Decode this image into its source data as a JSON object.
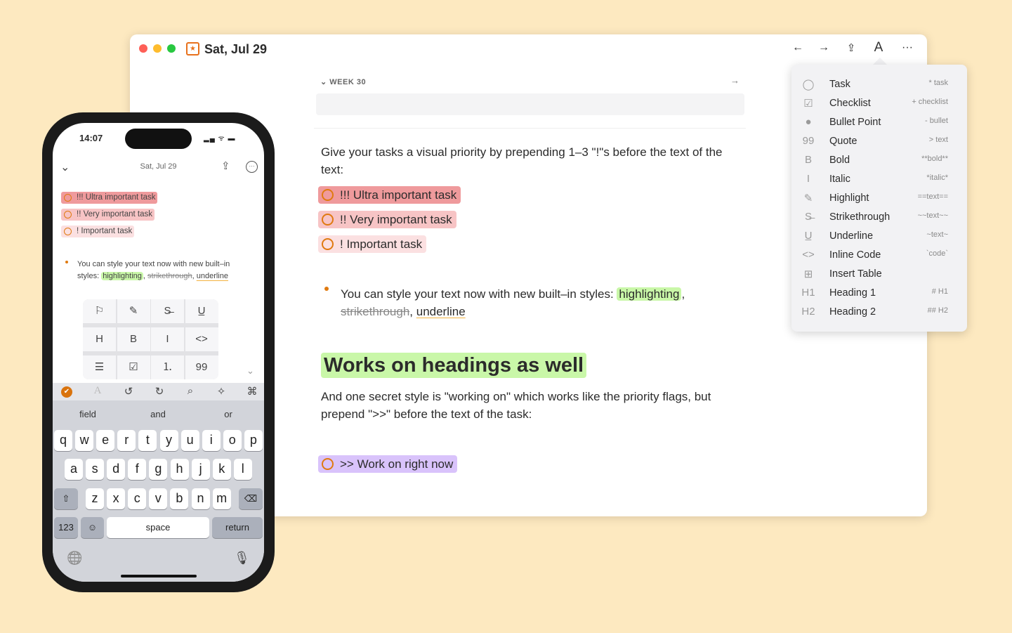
{
  "window": {
    "title": "Sat, Jul 29",
    "week_label": "WEEK 30",
    "toolbar": {
      "back": "←",
      "forward": "→",
      "share": "share-icon",
      "font": "A",
      "more": "···"
    },
    "intro": "Give your tasks a visual priority by prepending 1–3 \"!\"s before the text of the text:",
    "tasks": [
      {
        "text": "!!! Ultra important task",
        "color": "#ef9a9c"
      },
      {
        "text": "!! Very important task",
        "color": "#f7c4c5"
      },
      {
        "text": "! Important task",
        "color": "#fbe0e1"
      }
    ],
    "bullet": {
      "before": "You can style your text now with new built–in styles: ",
      "highlight": "highlighting",
      "comma1": ",",
      "strike": "strikethrough",
      "comma2": ", ",
      "underline": "underline"
    },
    "heading": "Works on headings as well",
    "secret": "And one secret style is \"working on\" which works like the priority flags, but prepend \">>\" before the text of the task:",
    "working_task": {
      "text": ">> Work on right now",
      "color": "#d9c3fb"
    }
  },
  "menu": [
    {
      "icon": "circle-check",
      "glyph": "◯",
      "label": "Task",
      "shortcut": "* task"
    },
    {
      "icon": "checkbox",
      "glyph": "☑",
      "label": "Checklist",
      "shortcut": "+ checklist"
    },
    {
      "icon": "bullet",
      "glyph": "●",
      "label": "Bullet Point",
      "shortcut": "- bullet"
    },
    {
      "icon": "quote",
      "glyph": "99",
      "label": "Quote",
      "shortcut": "> text"
    },
    {
      "icon": "bold",
      "glyph": "B",
      "label": "Bold",
      "shortcut": "**bold**"
    },
    {
      "icon": "italic",
      "glyph": "I",
      "label": "Italic",
      "shortcut": "*italic*"
    },
    {
      "icon": "highlighter",
      "glyph": "✎",
      "label": "Highlight",
      "shortcut": "==text=="
    },
    {
      "icon": "strikethrough",
      "glyph": "S̶",
      "label": "Strikethrough",
      "shortcut": "~~text~~"
    },
    {
      "icon": "underline",
      "glyph": "U̲",
      "label": "Underline",
      "shortcut": "~text~"
    },
    {
      "icon": "code",
      "glyph": "<>",
      "label": "Inline Code",
      "shortcut": "`code`"
    },
    {
      "icon": "table",
      "glyph": "⊞",
      "label": "Insert Table",
      "shortcut": ""
    },
    {
      "icon": "heading1",
      "glyph": "H1",
      "label": "Heading 1",
      "shortcut": "# H1"
    },
    {
      "icon": "heading2",
      "glyph": "H2",
      "label": "Heading 2",
      "shortcut": "## H2"
    }
  ],
  "phone": {
    "time": "14:07",
    "date": "Sat, Jul 29",
    "tasks": [
      {
        "text": "!!! Ultra important task",
        "color": "#ef9a9c"
      },
      {
        "text": "!! Very important task",
        "color": "#f7c4c5"
      },
      {
        "text": "! Important task",
        "color": "#fbe0e1"
      }
    ],
    "bullet": {
      "line1": "You can style your text now with new built–in",
      "styles": "styles: ",
      "highlight": "highlighting",
      "comma": ", ",
      "strike": "strikethrough",
      "underline": "underline"
    },
    "format_grid": [
      {
        "icon": "flag",
        "glyph": "⚐"
      },
      {
        "icon": "highlighter",
        "glyph": "✎"
      },
      {
        "icon": "strikethrough",
        "glyph": "S̶"
      },
      {
        "icon": "underline",
        "glyph": "U̲"
      },
      {
        "icon": "heading",
        "glyph": "H"
      },
      {
        "icon": "bold",
        "glyph": "B"
      },
      {
        "icon": "italic",
        "glyph": "I"
      },
      {
        "icon": "code",
        "glyph": "<>"
      },
      {
        "icon": "list",
        "glyph": "☰"
      },
      {
        "icon": "checkbox",
        "glyph": "☑"
      },
      {
        "icon": "numbered-list",
        "glyph": "⒈"
      },
      {
        "icon": "quote",
        "glyph": "99"
      }
    ],
    "toolbar": [
      {
        "icon": "check-circle",
        "glyph": "✔"
      },
      {
        "icon": "font",
        "glyph": "A"
      },
      {
        "icon": "undo",
        "glyph": "↺"
      },
      {
        "icon": "redo",
        "glyph": "↻"
      },
      {
        "icon": "search",
        "glyph": "⌕"
      },
      {
        "icon": "sparkles",
        "glyph": "✧"
      },
      {
        "icon": "command",
        "glyph": "⌘"
      }
    ],
    "suggestions": [
      "field",
      "and",
      "or"
    ],
    "rows": [
      [
        "q",
        "w",
        "e",
        "r",
        "t",
        "y",
        "u",
        "i",
        "o",
        "p"
      ],
      [
        "a",
        "s",
        "d",
        "f",
        "g",
        "h",
        "j",
        "k",
        "l"
      ],
      [
        "z",
        "x",
        "c",
        "v",
        "b",
        "n",
        "m"
      ]
    ],
    "keys": {
      "shift": "⇧",
      "delete": "⌫",
      "numbers": "123",
      "emoji": "☺",
      "space": "space",
      "return": "return",
      "globe": "🌐",
      "mic": "🎙"
    }
  },
  "colors": {
    "accent": "#e07a10",
    "highlight": "#c9f7a8"
  }
}
